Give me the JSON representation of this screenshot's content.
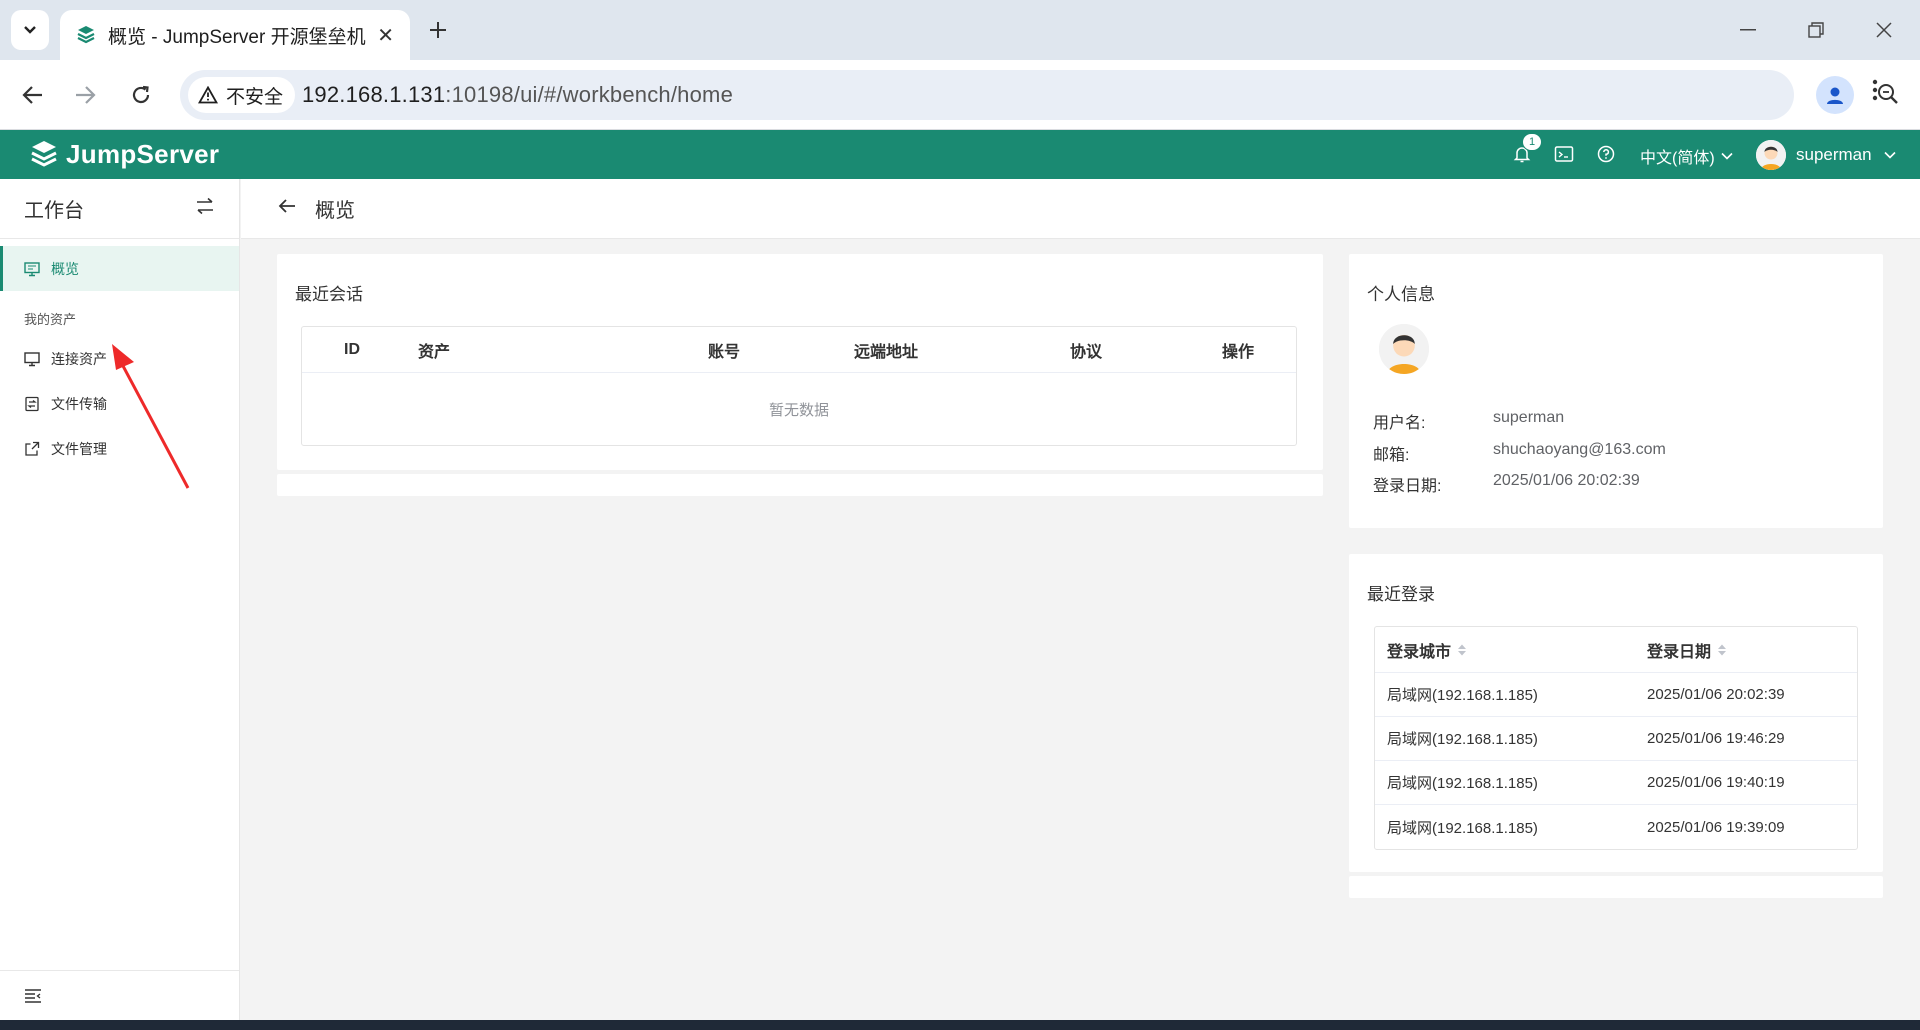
{
  "browser": {
    "tab_title": "概览 - JumpServer 开源堡垒机",
    "insecure_label": "不安全",
    "url_host": "192.168.1.131",
    "url_rest": ":10198/ui/#/workbench/home"
  },
  "header": {
    "brand": "JumpServer",
    "notification_count": "1",
    "language": "中文(简体)",
    "username": "superman",
    "accent_color": "#1a8a72"
  },
  "sidebar": {
    "title": "工作台",
    "items": [
      {
        "label": "概览",
        "icon": "monitor-icon"
      },
      {
        "label": "连接资产",
        "icon": "desktop-icon"
      },
      {
        "label": "文件传输",
        "icon": "file-transfer-icon"
      },
      {
        "label": "文件管理",
        "icon": "external-link-icon"
      }
    ],
    "group_label": "我的资产"
  },
  "page": {
    "title": "概览"
  },
  "recent_sessions": {
    "title": "最近会话",
    "columns": [
      "ID",
      "资产",
      "账号",
      "远端地址",
      "协议",
      "操作"
    ],
    "empty_text": "暂无数据"
  },
  "profile": {
    "title": "个人信息",
    "username_label": "用户名:",
    "username": "superman",
    "email_label": "邮箱:",
    "email": "shuchaoyang@163.com",
    "login_date_label": "登录日期:",
    "login_date": "2025/01/06 20:02:39"
  },
  "recent_logins": {
    "title": "最近登录",
    "columns": [
      "登录城市",
      "登录日期"
    ],
    "rows": [
      {
        "city": "局域网(192.168.1.185)",
        "date": "2025/01/06 20:02:39"
      },
      {
        "city": "局域网(192.168.1.185)",
        "date": "2025/01/06 19:46:29"
      },
      {
        "city": "局域网(192.168.1.185)",
        "date": "2025/01/06 19:40:19"
      },
      {
        "city": "局域网(192.168.1.185)",
        "date": "2025/01/06 19:39:09"
      }
    ]
  }
}
